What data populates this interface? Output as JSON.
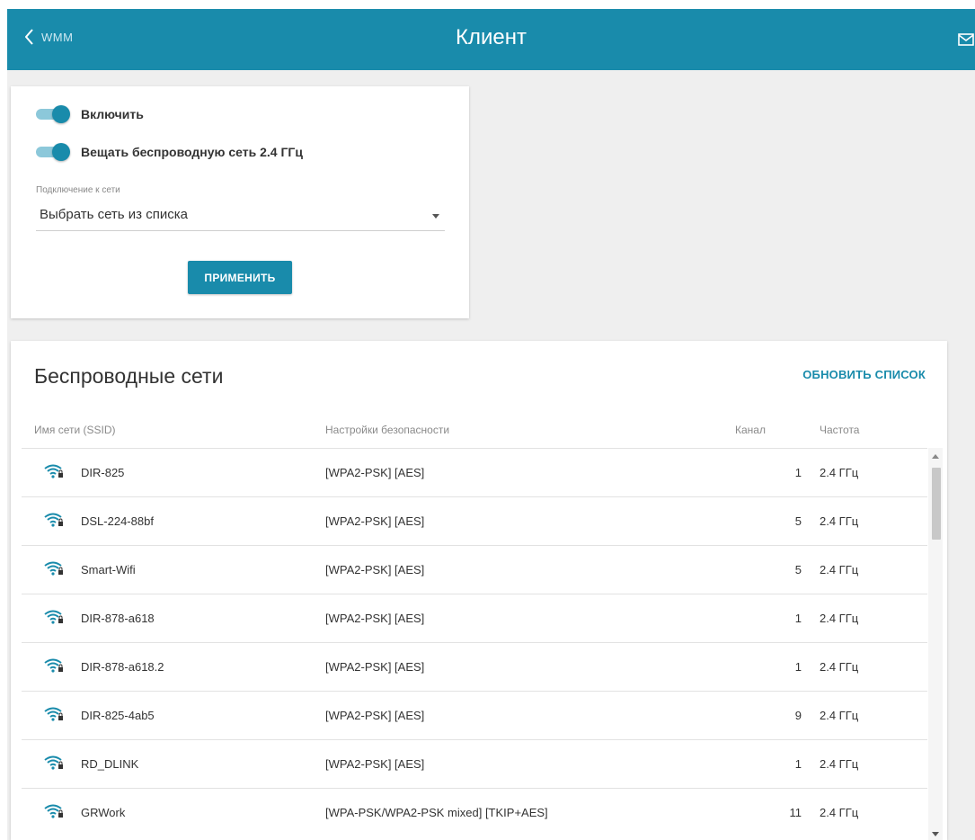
{
  "header": {
    "back_label": "WMM",
    "title": "Клиент"
  },
  "settings": {
    "enable_label": "Включить",
    "enable_on": true,
    "broadcast_label": "Вещать беспроводную сеть 2.4 ГГц",
    "broadcast_on": true,
    "connection_caption": "Подключение к сети",
    "connection_value": "Выбрать сеть из списка",
    "apply_label": "ПРИМЕНИТЬ"
  },
  "networks": {
    "title": "Беспроводные сети",
    "refresh_label": "ОБНОВИТЬ СПИСОК",
    "columns": {
      "ssid": "Имя сети (SSID)",
      "security": "Настройки безопасности",
      "channel": "Канал",
      "frequency": "Частота"
    },
    "rows": [
      {
        "ssid": "DIR-825",
        "security": "[WPA2-PSK] [AES]",
        "channel": "1",
        "frequency": "2.4 ГГц"
      },
      {
        "ssid": "DSL-224-88bf",
        "security": "[WPA2-PSK] [AES]",
        "channel": "5",
        "frequency": "2.4 ГГц"
      },
      {
        "ssid": "Smart-Wifi",
        "security": "[WPA2-PSK] [AES]",
        "channel": "5",
        "frequency": "2.4 ГГц"
      },
      {
        "ssid": "DIR-878-a618",
        "security": "[WPA2-PSK] [AES]",
        "channel": "1",
        "frequency": "2.4 ГГц"
      },
      {
        "ssid": "DIR-878-a618.2",
        "security": "[WPA2-PSK] [AES]",
        "channel": "1",
        "frequency": "2.4 ГГц"
      },
      {
        "ssid": "DIR-825-4ab5",
        "security": "[WPA2-PSK] [AES]",
        "channel": "9",
        "frequency": "2.4 ГГц"
      },
      {
        "ssid": "RD_DLINK",
        "security": "[WPA2-PSK] [AES]",
        "channel": "1",
        "frequency": "2.4 ГГц"
      },
      {
        "ssid": "GRWork",
        "security": "[WPA-PSK/WPA2-PSK mixed] [TKIP+AES]",
        "channel": "11",
        "frequency": "2.4 ГГц"
      }
    ]
  },
  "icons": {
    "back": "chevron-left-icon",
    "mail": "mail-icon",
    "wifi": "wifi-lock-icon",
    "dropdown": "caret-down-icon"
  },
  "colors": {
    "accent": "#198bab",
    "toggle_track": "#8cc8da",
    "background": "#efefef"
  }
}
